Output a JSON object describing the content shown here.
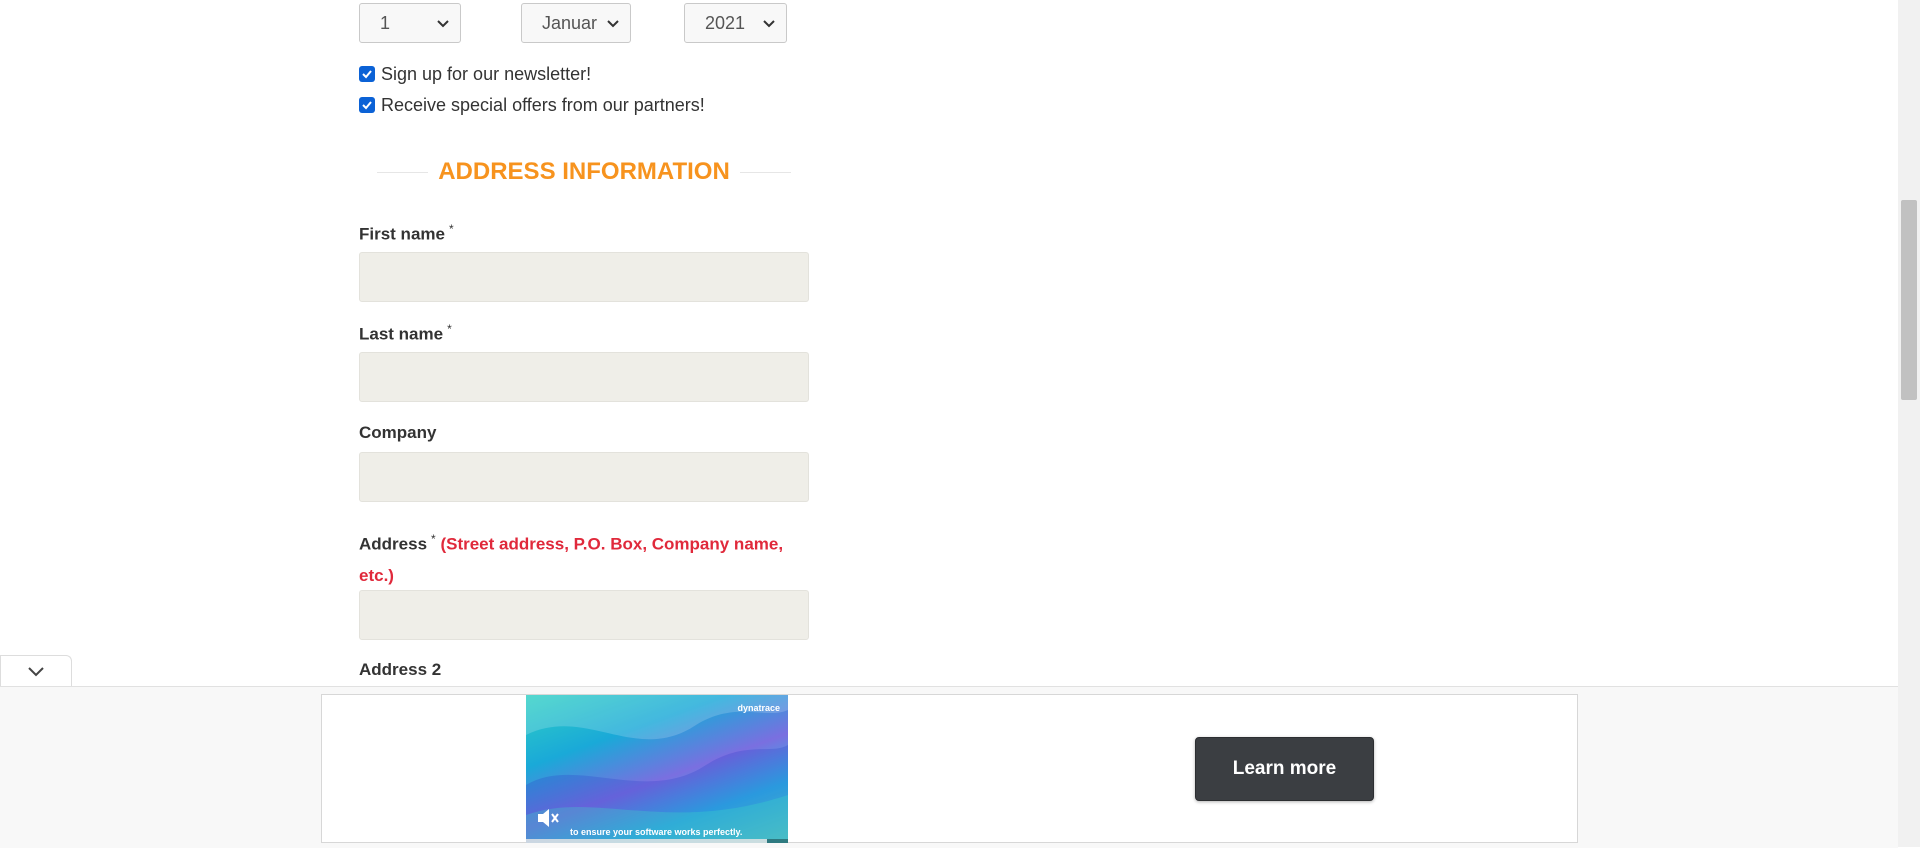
{
  "dob": {
    "day": "1",
    "month": "Januar",
    "year": "2021"
  },
  "options": {
    "newsletter": {
      "label": "Sign up for our newsletter!",
      "checked": true
    },
    "partners": {
      "label": "Receive special offers from our partners!",
      "checked": true
    }
  },
  "address_section": {
    "title": "ADDRESS INFORMATION",
    "first_name": {
      "label": "First name",
      "required_mark": "*",
      "value": ""
    },
    "last_name": {
      "label": "Last name",
      "required_mark": "*",
      "value": ""
    },
    "company": {
      "label": "Company",
      "value": ""
    },
    "address": {
      "label": "Address",
      "required_mark": "*",
      "hint": "(Street address, P.O. Box, Company name, etc.)",
      "value": ""
    },
    "address2": {
      "label": "Address 2"
    }
  },
  "ad": {
    "brand": "dynatrace",
    "caption": "to ensure your software works perfectly.",
    "button": "Learn more",
    "progress": 0.92
  },
  "colors": {
    "accent": "#f7931e",
    "hint": "#e0293b",
    "field_bg": "#efeee8",
    "checkbox": "#0b62d6",
    "ad_button": "#3b3e42"
  },
  "icons": {
    "select_arrow": "chevron-down-icon",
    "checkbox": "checkmark-icon",
    "collapse": "chevron-down-icon",
    "mute": "muted-speaker-icon"
  }
}
